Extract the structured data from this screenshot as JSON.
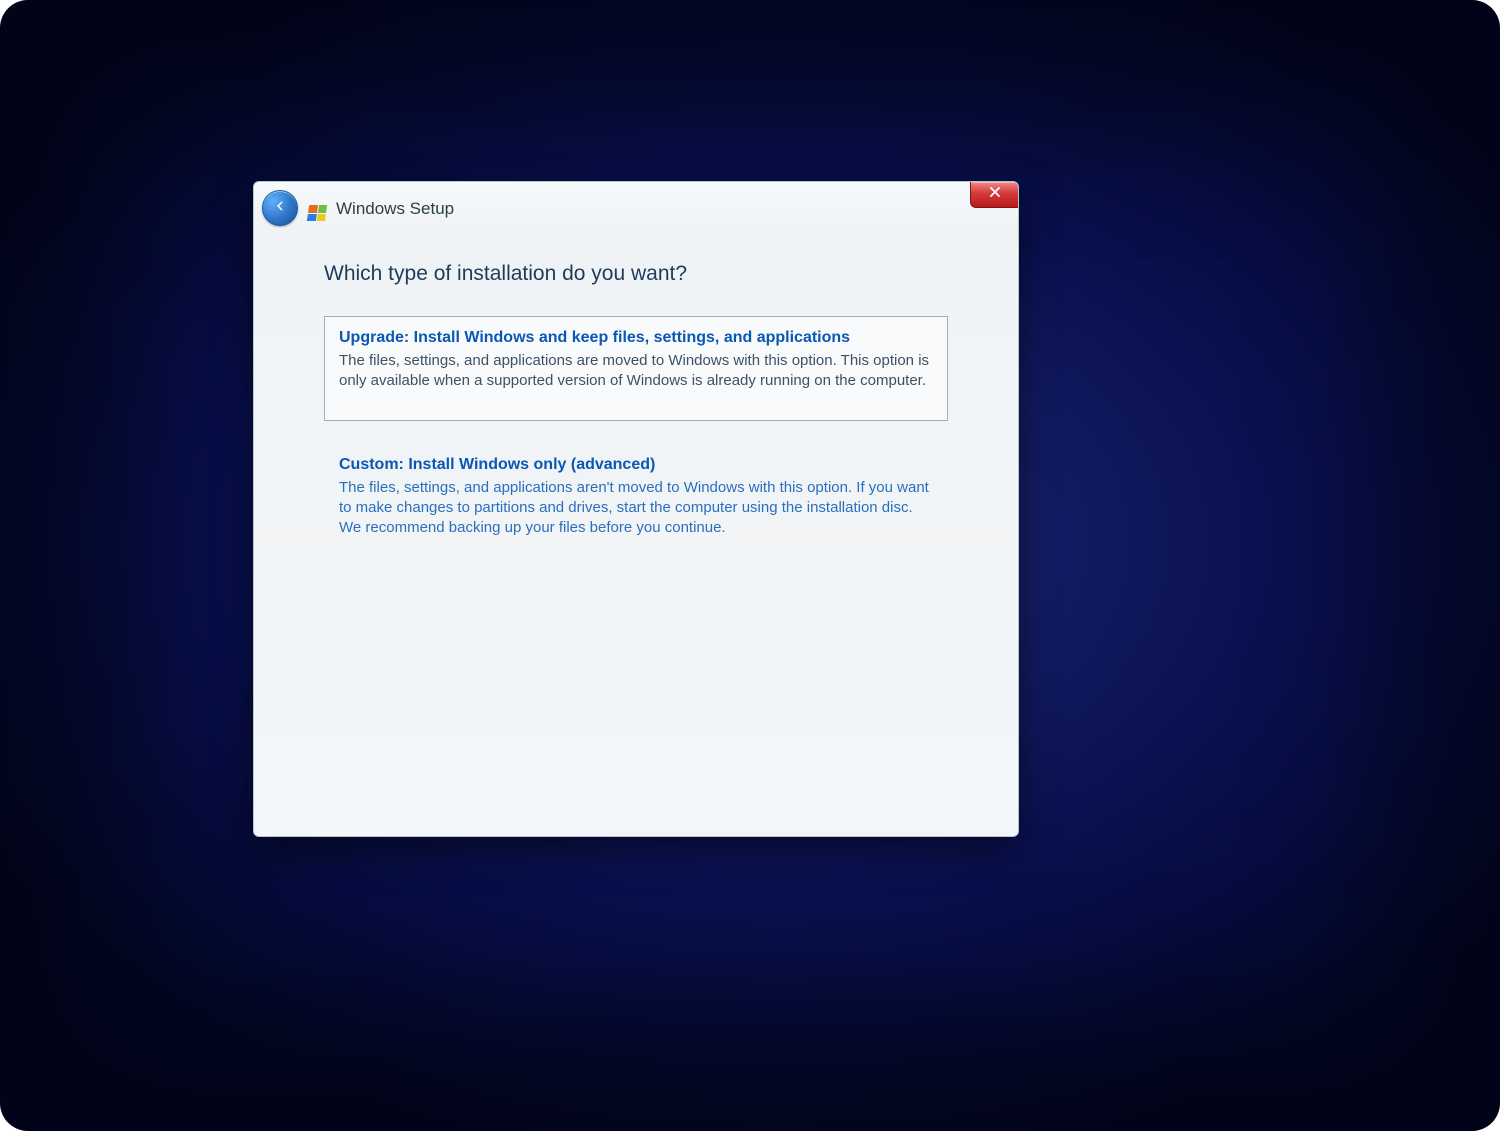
{
  "titlebar": {
    "title": "Windows Setup"
  },
  "heading": "Which type of installation do you want?",
  "options": [
    {
      "title": "Upgrade: Install Windows and keep files, settings, and applications",
      "desc": "The files, settings, and applications are moved to Windows with this option. This option is only available when a supported version of Windows is already running on the computer."
    },
    {
      "title": "Custom: Install Windows only (advanced)",
      "desc": "The files, settings, and applications aren't moved to Windows with this option. If you want to make changes to partitions and drives, start the computer using the installation disc. We recommend backing up your files before you continue."
    }
  ]
}
